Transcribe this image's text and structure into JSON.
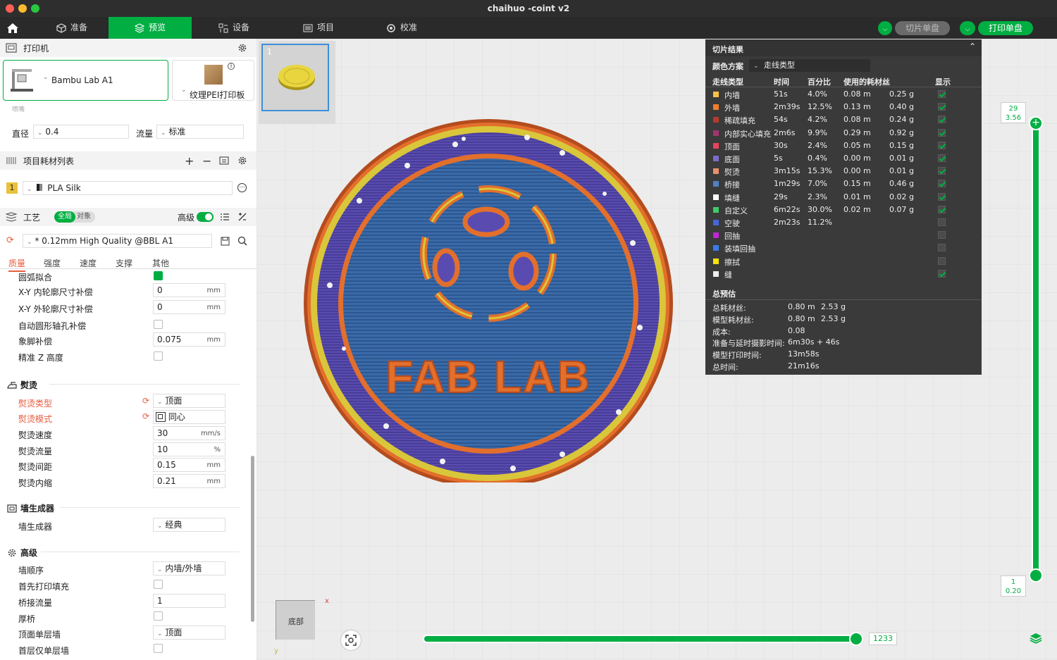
{
  "window": {
    "title": "chaihuo -coint v2"
  },
  "nav": {
    "tabs": [
      {
        "label": "准备"
      },
      {
        "label": "预览"
      },
      {
        "label": "设备"
      },
      {
        "label": "项目"
      },
      {
        "label": "校准"
      }
    ],
    "slice_plate": "切片单盘",
    "print_plate": "打印单盘"
  },
  "printer": {
    "section": "打印机",
    "name": "Bambu Lab A1",
    "plate": "纹理PEI打印板",
    "nozzle_label": "喷嘴",
    "diameter_label": "直径",
    "diameter": "0.4",
    "flow_label": "流量",
    "flow": "标准"
  },
  "filament": {
    "section": "项目耗材列表",
    "slot": "1",
    "name": "PLA Silk"
  },
  "process": {
    "section": "工艺",
    "global": "全局",
    "object": "对象",
    "advanced": "高级",
    "profile": "* 0.12mm High Quality @BBL A1",
    "tabs": [
      "质量",
      "强度",
      "速度",
      "支撑",
      "其他"
    ]
  },
  "settings": {
    "arc_fitting": "圆弧拟合",
    "xy_hole": {
      "label": "X-Y 内轮廓尺寸补偿",
      "value": "0",
      "unit": "mm"
    },
    "xy_contour": {
      "label": "X-Y 外轮廓尺寸补偿",
      "value": "0",
      "unit": "mm"
    },
    "auto_circle": {
      "label": "自动圆形轴孔补偿"
    },
    "elephant": {
      "label": "象脚补偿",
      "value": "0.075",
      "unit": "mm"
    },
    "precise_z": {
      "label": "精准 Z 高度"
    },
    "ironing_group": "熨烫",
    "ironing_type": {
      "label": "熨烫类型",
      "value": "顶面"
    },
    "ironing_pattern": {
      "label": "熨烫模式",
      "value": "同心"
    },
    "ironing_speed": {
      "label": "熨烫速度",
      "value": "30",
      "unit": "mm/s"
    },
    "ironing_flow": {
      "label": "熨烫流量",
      "value": "10",
      "unit": "%"
    },
    "ironing_spacing": {
      "label": "熨烫间距",
      "value": "0.15",
      "unit": "mm"
    },
    "ironing_inset": {
      "label": "熨烫内缩",
      "value": "0.21",
      "unit": "mm"
    },
    "wall_group": "墙生成器",
    "wall_gen": {
      "label": "墙生成器",
      "value": "经典"
    },
    "adv_group": "高级",
    "wall_order": {
      "label": "墙顺序",
      "value": "内墙/外墙"
    },
    "infill_first": {
      "label": "首先打印填充"
    },
    "bridge_flow": {
      "label": "桥接流量",
      "value": "1"
    },
    "thick_bridge": {
      "label": "厚桥"
    },
    "top_one_wall": {
      "label": "顶面单层墙",
      "value": "顶面"
    },
    "first_one_wall": {
      "label": "首层仅单层墙"
    }
  },
  "plate_thumb": {
    "index": "1"
  },
  "coin_text": {
    "center": "FAB LAB"
  },
  "results": {
    "title": "切片结果",
    "scheme_label": "颜色方案",
    "scheme_value": "走线类型",
    "headers": [
      "走线类型",
      "时间",
      "百分比",
      "使用的耗材丝",
      "显示"
    ],
    "rows": [
      {
        "name": "内墙",
        "color": "#f6c244",
        "time": "51s",
        "pct": "4.0%",
        "len": "0.08 m",
        "wt": "0.25 g",
        "show": true
      },
      {
        "name": "外墙",
        "color": "#f07f2b",
        "time": "2m39s",
        "pct": "12.5%",
        "len": "0.13 m",
        "wt": "0.40 g",
        "show": true
      },
      {
        "name": "稀疏填充",
        "color": "#b33b2d",
        "time": "54s",
        "pct": "4.2%",
        "len": "0.08 m",
        "wt": "0.24 g",
        "show": true
      },
      {
        "name": "内部实心填充",
        "color": "#a1346e",
        "time": "2m6s",
        "pct": "9.9%",
        "len": "0.29 m",
        "wt": "0.92 g",
        "show": true
      },
      {
        "name": "顶面",
        "color": "#e9435a",
        "time": "30s",
        "pct": "2.4%",
        "len": "0.05 m",
        "wt": "0.15 g",
        "show": true
      },
      {
        "name": "底面",
        "color": "#7a6cc9",
        "time": "5s",
        "pct": "0.4%",
        "len": "0.00 m",
        "wt": "0.01 g",
        "show": true
      },
      {
        "name": "熨烫",
        "color": "#ea8f6e",
        "time": "3m15s",
        "pct": "15.3%",
        "len": "0.00 m",
        "wt": "0.01 g",
        "show": true
      },
      {
        "name": "桥接",
        "color": "#4f82c2",
        "time": "1m29s",
        "pct": "7.0%",
        "len": "0.15 m",
        "wt": "0.46 g",
        "show": true
      },
      {
        "name": "填缝",
        "color": "#ffffff",
        "time": "29s",
        "pct": "2.3%",
        "len": "0.01 m",
        "wt": "0.02 g",
        "show": true
      },
      {
        "name": "自定义",
        "color": "#3ecb6a",
        "time": "6m22s",
        "pct": "30.0%",
        "len": "0.02 m",
        "wt": "0.07 g",
        "show": true
      },
      {
        "name": "空驶",
        "color": "#4466dd",
        "time": "2m23s",
        "pct": "11.2%",
        "len": "",
        "wt": "",
        "show": false
      },
      {
        "name": "回抽",
        "color": "#c026d3",
        "time": "",
        "pct": "",
        "len": "",
        "wt": "",
        "show": false
      },
      {
        "name": "装填回抽",
        "color": "#3b7be8",
        "time": "",
        "pct": "",
        "len": "",
        "wt": "",
        "show": false
      },
      {
        "name": "擦拭",
        "color": "#f5e20d",
        "time": "",
        "pct": "",
        "len": "",
        "wt": "",
        "show": false
      },
      {
        "name": "缝",
        "color": "#eeeeee",
        "time": "",
        "pct": "",
        "len": "",
        "wt": "",
        "show": true
      }
    ],
    "estimate_title": "总预估",
    "estimates": [
      {
        "label": "总耗材丝:",
        "v1": "0.80 m",
        "v2": "2.53 g"
      },
      {
        "label": "模型耗材丝:",
        "v1": "0.80 m",
        "v2": "2.53 g"
      },
      {
        "label": "成本:",
        "v1": "0.08",
        "v2": ""
      },
      {
        "label": "准备与延时摄影时间:",
        "v1": "6m30s + 46s",
        "v2": ""
      },
      {
        "label": "模型打印时间:",
        "v1": "13m58s",
        "v2": ""
      },
      {
        "label": "总时间:",
        "v1": "21m16s",
        "v2": ""
      }
    ]
  },
  "layer_slider": {
    "top_layer": "29",
    "top_height": "3.56",
    "bottom_layer": "1",
    "bottom_height": "0.20"
  },
  "move_slider": {
    "value": "1233"
  },
  "axis": {
    "view": "底部",
    "x": "x",
    "y": "y"
  }
}
